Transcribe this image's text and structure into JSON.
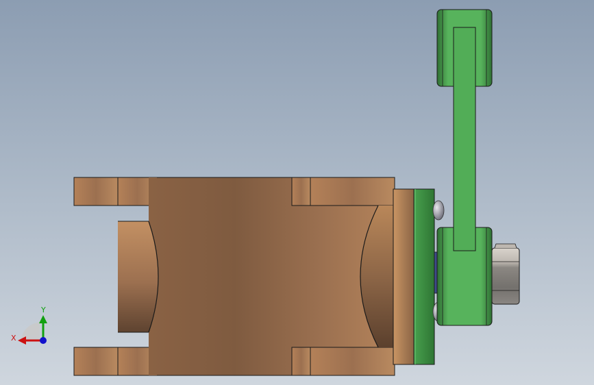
{
  "viewport": {
    "background_top": "#8c9db2",
    "background_bottom": "#cfd6de"
  },
  "colors": {
    "bronze": "#a87a55",
    "bronze_dark": "#6e5037",
    "bronze_light": "#c18c60",
    "green": "#4fa855",
    "green_dark": "#2f6e33",
    "steel": "#8a8a8a",
    "steel_light": "#cfcac4",
    "edge": "#1a1a1a"
  },
  "triad": {
    "x_label": "X",
    "y_label": "Y",
    "x_color": "#cc1111",
    "y_color": "#11a011",
    "z_color": "#1111cc"
  }
}
